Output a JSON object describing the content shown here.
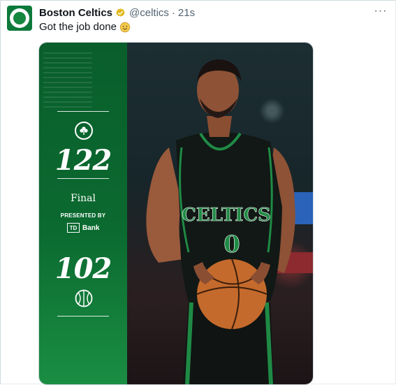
{
  "post": {
    "author_name": "Boston Celtics",
    "handle": "@celtics",
    "separator": "·",
    "time": "21s",
    "more_label": "···",
    "text": "Got the job done"
  },
  "graphic": {
    "home_score": "122",
    "status": "Final",
    "presented_by": "PRESENTED BY",
    "sponsor_mark": "TD",
    "sponsor_name": "Bank",
    "away_score": "102",
    "jersey_text": "CELTICS",
    "jersey_number": "0"
  },
  "colors": {
    "celtics_green": "#0b6a30",
    "verified_gold": "#e2b719",
    "handle_gray": "#536471"
  },
  "icons": {
    "verified": "gold-verified-badge-icon",
    "emoji": "slightly-smiling-face-emoji",
    "home_team": "celtics-clover-logo-icon",
    "away_team": "basketball-icon"
  }
}
